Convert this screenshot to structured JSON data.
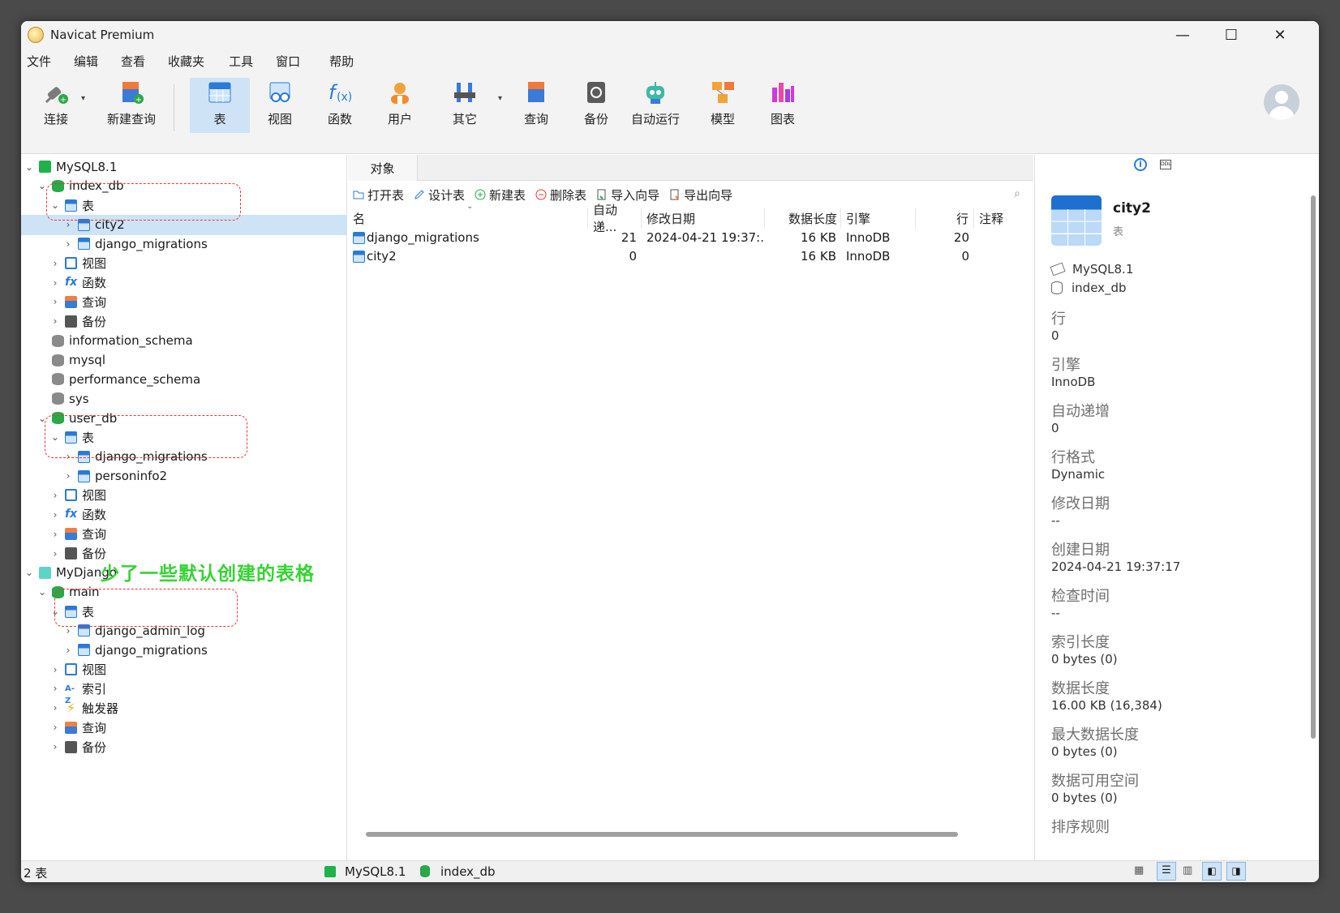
{
  "window": {
    "title": "Navicat Premium",
    "minimize": "—",
    "maximize": "☐",
    "close": "✕"
  },
  "menu": [
    "文件",
    "编辑",
    "查看",
    "收藏夹",
    "工具",
    "窗口",
    "帮助"
  ],
  "toolbar": {
    "connect": "连接",
    "new_query": "新建查询",
    "table": "表",
    "view": "视图",
    "function": "函数",
    "user": "用户",
    "other": "其它",
    "query": "查询",
    "backup": "备份",
    "auto_run": "自动运行",
    "model": "模型",
    "chart": "图表"
  },
  "tree": [
    {
      "label": "MySQL8.1",
      "level": 0,
      "icon": "connection-icon",
      "chev": "v"
    },
    {
      "label": "index_db",
      "level": 1,
      "icon": "database-icon",
      "chev": "v"
    },
    {
      "label": "表",
      "level": 2,
      "icon": "table-group-icon",
      "chev": "v"
    },
    {
      "label": "city2",
      "level": 3,
      "icon": "table-icon",
      "chev": ">",
      "selected": true
    },
    {
      "label": "django_migrations",
      "level": 3,
      "icon": "table-icon",
      "chev": ">"
    },
    {
      "label": "视图",
      "level": 2,
      "icon": "view-icon",
      "chev": ">"
    },
    {
      "label": "函数",
      "level": 2,
      "icon": "function-icon",
      "chev": ">"
    },
    {
      "label": "查询",
      "level": 2,
      "icon": "query-icon",
      "chev": ">"
    },
    {
      "label": "备份",
      "level": 2,
      "icon": "backup-icon",
      "chev": ">"
    },
    {
      "label": "information_schema",
      "level": 1,
      "icon": "database-gray-icon",
      "chev": ""
    },
    {
      "label": "mysql",
      "level": 1,
      "icon": "database-gray-icon",
      "chev": ""
    },
    {
      "label": "performance_schema",
      "level": 1,
      "icon": "database-gray-icon",
      "chev": ""
    },
    {
      "label": "sys",
      "level": 1,
      "icon": "database-gray-icon",
      "chev": ""
    },
    {
      "label": "user_db",
      "level": 1,
      "icon": "database-icon",
      "chev": "v"
    },
    {
      "label": "表",
      "level": 2,
      "icon": "table-group-icon",
      "chev": "v"
    },
    {
      "label": "django_migrations",
      "level": 3,
      "icon": "table-icon",
      "chev": ">"
    },
    {
      "label": "personinfo2",
      "level": 3,
      "icon": "table-icon",
      "chev": ">"
    },
    {
      "label": "视图",
      "level": 2,
      "icon": "view-icon",
      "chev": ">"
    },
    {
      "label": "函数",
      "level": 2,
      "icon": "function-icon",
      "chev": ">"
    },
    {
      "label": "查询",
      "level": 2,
      "icon": "query-icon",
      "chev": ">"
    },
    {
      "label": "备份",
      "level": 2,
      "icon": "backup-icon",
      "chev": ">"
    },
    {
      "label": "MyDjango",
      "level": 0,
      "icon": "sqlite-connection-icon",
      "chev": "v"
    },
    {
      "label": "main",
      "level": 1,
      "icon": "database-icon",
      "chev": "v"
    },
    {
      "label": "表",
      "level": 2,
      "icon": "table-group-icon",
      "chev": "v"
    },
    {
      "label": "django_admin_log",
      "level": 3,
      "icon": "table-icon",
      "chev": ">"
    },
    {
      "label": "django_migrations",
      "level": 3,
      "icon": "table-icon",
      "chev": ">"
    },
    {
      "label": "视图",
      "level": 2,
      "icon": "view-icon",
      "chev": ">"
    },
    {
      "label": "索引",
      "level": 2,
      "icon": "index-icon",
      "chev": ">"
    },
    {
      "label": "触发器",
      "level": 2,
      "icon": "trigger-icon",
      "chev": ">"
    },
    {
      "label": "查询",
      "level": 2,
      "icon": "query-icon",
      "chev": ">"
    },
    {
      "label": "备份",
      "level": 2,
      "icon": "backup-icon",
      "chev": ">"
    }
  ],
  "annotation": "少了一些默认创建的表格",
  "objects": {
    "tab": "对象",
    "actions": [
      "打开表",
      "设计表",
      "新建表",
      "删除表",
      "导入向导",
      "导出向导"
    ],
    "columns": [
      "名",
      "自动递...",
      "修改日期",
      "数据长度",
      "引擎",
      "行",
      "注释"
    ],
    "rows": [
      [
        "django_migrations",
        "21",
        "2024-04-21 19:37:...",
        "16 KB",
        "InnoDB",
        "20",
        ""
      ],
      [
        "city2",
        "0",
        "",
        "16 KB",
        "InnoDB",
        "0",
        ""
      ]
    ]
  },
  "info": {
    "name": "city2",
    "type": "表",
    "connection": "MySQL8.1",
    "database": "index_db",
    "props": [
      {
        "label": "行",
        "value": "0"
      },
      {
        "label": "引擎",
        "value": "InnoDB"
      },
      {
        "label": "自动递增",
        "value": "0"
      },
      {
        "label": "行格式",
        "value": "Dynamic"
      },
      {
        "label": "修改日期",
        "value": "--"
      },
      {
        "label": "创建日期",
        "value": "2024-04-21 19:37:17"
      },
      {
        "label": "检查时间",
        "value": "--"
      },
      {
        "label": "索引长度",
        "value": "0 bytes (0)"
      },
      {
        "label": "数据长度",
        "value": "16.00 KB (16,384)"
      },
      {
        "label": "最大数据长度",
        "value": "0 bytes (0)"
      },
      {
        "label": "数据可用空间",
        "value": "0 bytes (0)"
      },
      {
        "label": "排序规则",
        "value": ""
      }
    ]
  },
  "status": {
    "count": "2 表",
    "connection": "MySQL8.1",
    "database": "index_db"
  }
}
